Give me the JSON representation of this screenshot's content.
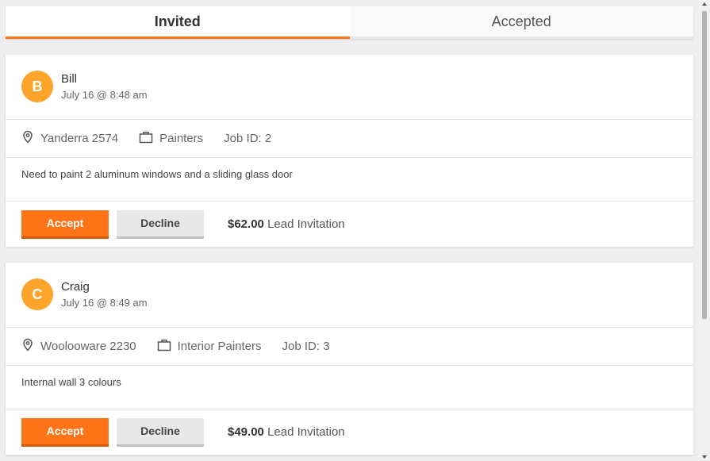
{
  "tabs": [
    {
      "label": "Invited",
      "active": true
    },
    {
      "label": "Accepted",
      "active": false
    }
  ],
  "accent_color": "#ff7417",
  "avatar_color": "#ffa42a",
  "leads": [
    {
      "initial": "B",
      "name": "Bill",
      "date": "July 16 @ 8:48 am",
      "location": "Yanderra 2574",
      "category": "Painters",
      "job_id": "Job ID: 2",
      "description": "Need to paint 2 aluminum windows and a sliding glass door",
      "accept_label": "Accept",
      "decline_label": "Decline",
      "price": "$62.00",
      "price_suffix": "Lead Invitation"
    },
    {
      "initial": "C",
      "name": "Craig",
      "date": "July 16 @ 8:49 am",
      "location": "Woolooware 2230",
      "category": "Interior Painters",
      "job_id": "Job ID: 3",
      "description": "Internal wall 3 colours",
      "accept_label": "Accept",
      "decline_label": "Decline",
      "price": "$49.00",
      "price_suffix": "Lead Invitation"
    }
  ],
  "icons": {
    "location": "map-pin-icon",
    "category": "briefcase-icon"
  }
}
